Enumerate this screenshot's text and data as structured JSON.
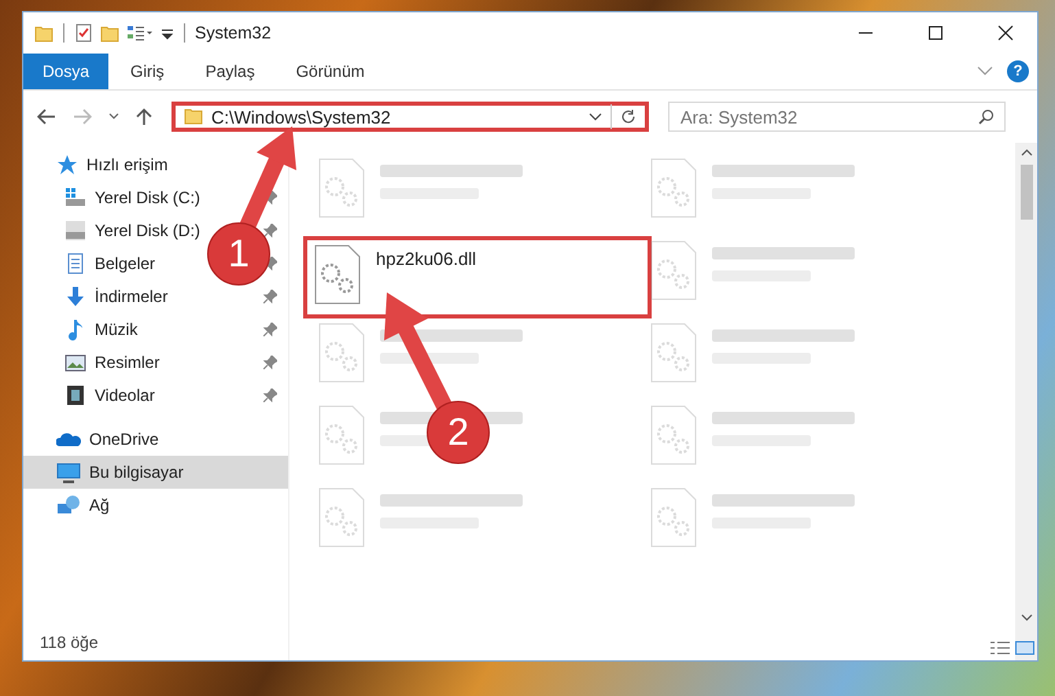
{
  "window": {
    "title": "System32"
  },
  "ribbon": {
    "tabs": [
      {
        "label": "Dosya",
        "selected": true
      },
      {
        "label": "Giriş",
        "selected": false
      },
      {
        "label": "Paylaş",
        "selected": false
      },
      {
        "label": "Görünüm",
        "selected": false
      }
    ],
    "help": "?"
  },
  "address_bar": {
    "path": "C:\\Windows\\System32",
    "annotated": true
  },
  "search": {
    "placeholder": "Ara: System32"
  },
  "sidebar": {
    "items": [
      {
        "label": "Hızlı erişim",
        "kind": "star",
        "selected": false,
        "children": [
          {
            "label": "Yerel Disk (C:)",
            "kind": "drive-win",
            "pinned": true,
            "selected": false
          },
          {
            "label": "Yerel Disk (D:)",
            "kind": "drive",
            "pinned": true,
            "selected": false
          },
          {
            "label": "Belgeler",
            "kind": "docs",
            "pinned": true,
            "selected": false
          },
          {
            "label": "İndirmeler",
            "kind": "download",
            "pinned": true,
            "selected": false
          },
          {
            "label": "Müzik",
            "kind": "music",
            "pinned": true,
            "selected": false
          },
          {
            "label": "Resimler",
            "kind": "pictures",
            "pinned": true,
            "selected": false
          },
          {
            "label": "Videolar",
            "kind": "video",
            "pinned": true,
            "selected": false
          }
        ]
      },
      {
        "label": "OneDrive",
        "kind": "cloud",
        "selected": false
      },
      {
        "label": "Bu bilgisayar",
        "kind": "pc",
        "selected": true
      },
      {
        "label": "Ağ",
        "kind": "network",
        "selected": false
      }
    ]
  },
  "files": [
    {
      "kind": "blurred",
      "annotated": false
    },
    {
      "kind": "blurred",
      "annotated": false
    },
    {
      "kind": "file",
      "name": "hpz2ku06.dll",
      "annotated": true
    },
    {
      "kind": "blurred",
      "annotated": false
    },
    {
      "kind": "blurred",
      "annotated": false
    },
    {
      "kind": "blurred",
      "annotated": false
    },
    {
      "kind": "blurred",
      "annotated": false
    },
    {
      "kind": "blurred",
      "annotated": false
    },
    {
      "kind": "blurred",
      "annotated": false
    },
    {
      "kind": "blurred",
      "annotated": false
    }
  ],
  "status_bar": {
    "count": "118 öğe"
  },
  "callouts": [
    "1",
    "2"
  ]
}
